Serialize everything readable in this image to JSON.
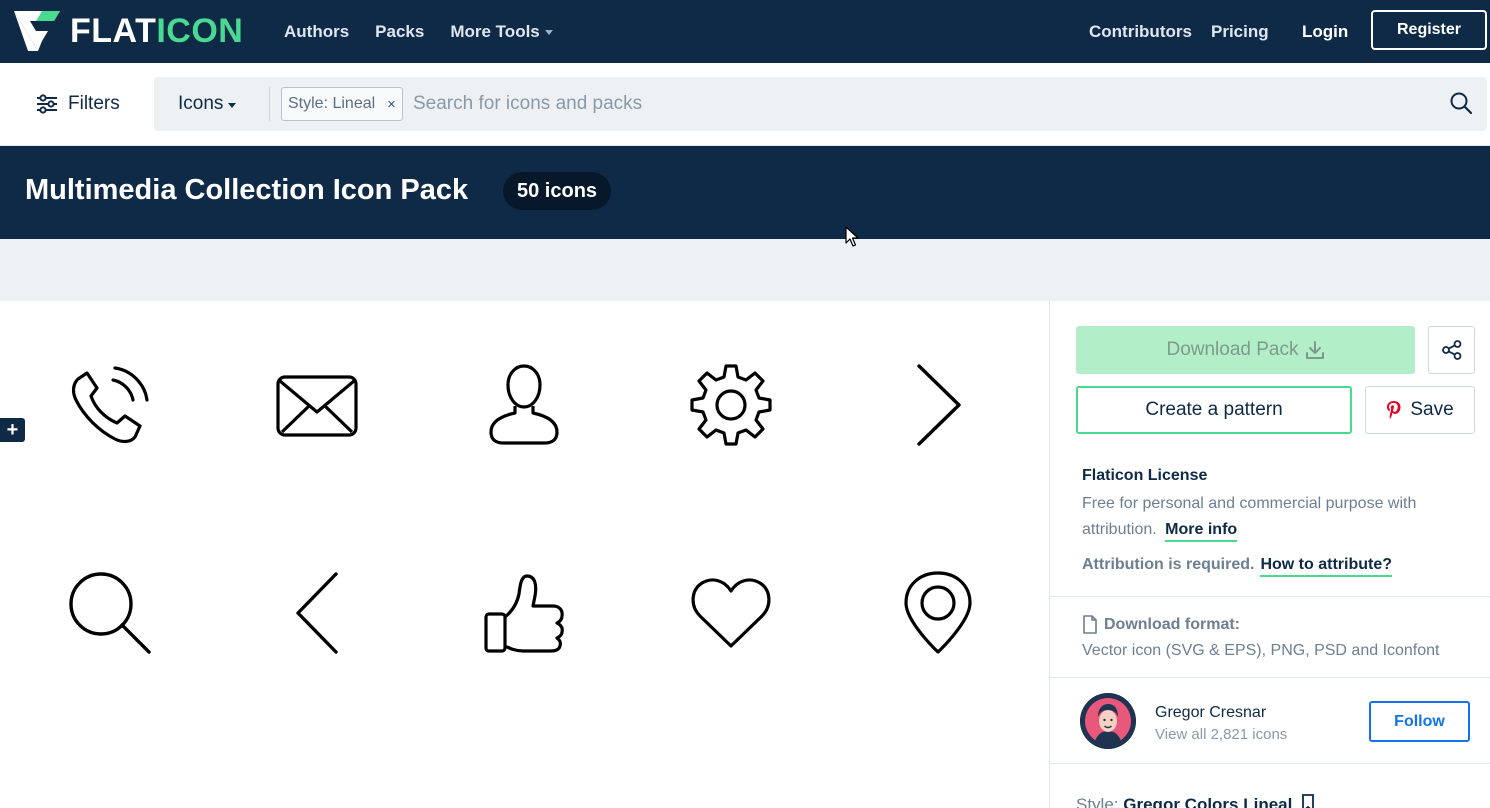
{
  "nav": {
    "logo_text_a": "FLAT",
    "logo_text_b": "ICON",
    "left_links": [
      "Authors",
      "Packs",
      "More Tools"
    ],
    "contributors": "Contributors",
    "pricing": "Pricing",
    "login": "Login",
    "register": "Register"
  },
  "search": {
    "filters_label": "Filters",
    "type_label": "Icons",
    "style_tag": "Style: Lineal",
    "tag_close": "×",
    "placeholder": "Search for icons and packs"
  },
  "banner": {
    "title": "Multimedia Collection Icon Pack",
    "count": "50 icons"
  },
  "grid": {
    "plus_label": "+",
    "icons": [
      "phone-ringing-icon",
      "envelope-icon",
      "user-icon",
      "gear-icon",
      "chevron-right-icon",
      "search-icon",
      "chevron-left-icon",
      "thumbs-up-icon",
      "heart-icon",
      "location-pin-icon"
    ]
  },
  "sidebar": {
    "download_pack": "Download Pack",
    "create_pattern": "Create a pattern",
    "save": "Save",
    "license_title": "Flaticon License",
    "license_text": "Free for personal and commercial purpose with attribution.",
    "more_info": "More info",
    "attribution_required": "Attribution is required.",
    "how_to_attribute": "How to attribute?",
    "format_title": "Download format:",
    "format_text": "Vector icon (SVG & EPS), PNG, PSD and Iconfont",
    "author_name": "Gregor Cresnar",
    "author_sub": "View all 2,821 icons",
    "follow": "Follow",
    "style_label": "Style:",
    "style_name": "Gregor Colors Lineal"
  },
  "colors": {
    "navy": "#0e2a47",
    "green": "#4ad991",
    "download_bg": "#b2efc8",
    "follow_blue": "#1273eb",
    "pinterest_red": "#e60023"
  }
}
